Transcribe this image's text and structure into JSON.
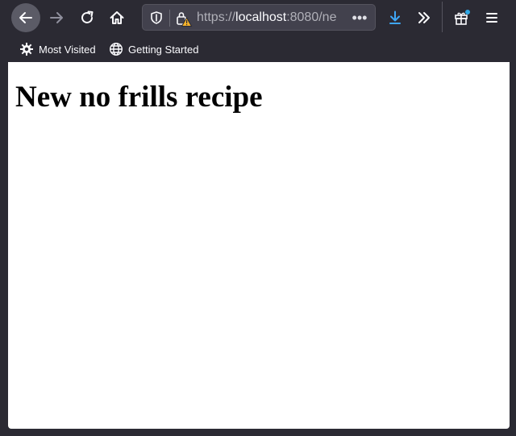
{
  "toolbar": {
    "icons": {
      "back": "back-arrow-icon",
      "forward": "forward-arrow-icon",
      "reload": "reload-icon",
      "home": "home-icon",
      "downloads": "download-icon",
      "overflow": "double-chevron-icon",
      "whats_new": "gift-icon",
      "menu": "hamburger-menu-icon"
    }
  },
  "urlbar": {
    "scheme": "https://",
    "host": "localhost",
    "rest": ":8080/ne",
    "more_label": "•••",
    "icons": {
      "tracking": "shield-icon",
      "security": "insecure-lock-warning-icon"
    }
  },
  "bookmarks": {
    "items": [
      {
        "label": "Most Visited",
        "icon": "gear-icon"
      },
      {
        "label": "Getting Started",
        "icon": "globe-icon"
      }
    ]
  },
  "page": {
    "heading": "New no frills recipe"
  },
  "colors": {
    "chrome_bg": "#2b2a33",
    "urlbar_bg": "#42414d",
    "download_accent": "#3fa7f7",
    "badge_accent": "#2ea8e6",
    "lock_warning": "#f7b32b"
  }
}
